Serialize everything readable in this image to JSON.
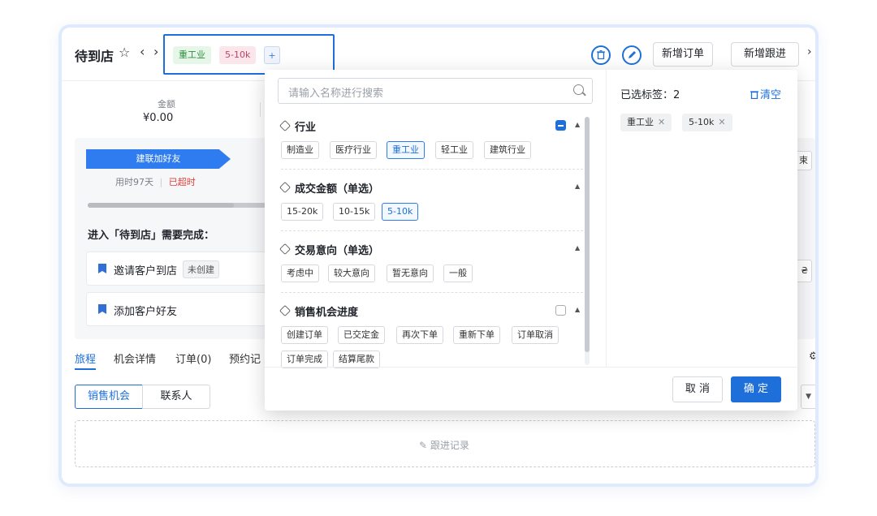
{
  "header": {
    "title": "待到店",
    "tags": [
      "重工业",
      "5-10k"
    ],
    "add_tag": "+",
    "buttons": {
      "new_order": "新增订单",
      "new_follow": "新增跟进"
    }
  },
  "summary": {
    "amount_label": "金额",
    "amount_value": "¥0.00"
  },
  "stage": {
    "name": "建联加好友",
    "time_used": "用时97天",
    "overdue": "已超时",
    "progress": 0.82
  },
  "requirements": {
    "title": "进入「待到店」需要完成：",
    "items": [
      {
        "label": "邀请客户到店",
        "badge": "未创建"
      },
      {
        "label": "添加客户好友",
        "badge": ""
      }
    ]
  },
  "side_stubs": [
    "束",
    "₴"
  ],
  "tabs": [
    "旅程",
    "机会详情",
    "订单(0)",
    "预约记"
  ],
  "segments": [
    "销售机会",
    "联系人"
  ],
  "follow_record": "跟进记录",
  "popup": {
    "search_placeholder": "请输入名称进行搜索",
    "categories": [
      {
        "title": "行业",
        "checkbox": "indeterminate",
        "options": [
          "制造业",
          "医疗行业",
          "重工业",
          "轻工业",
          "建筑行业"
        ],
        "selected": [
          "重工业"
        ]
      },
      {
        "title": "成交金额（单选）",
        "checkbox": "none",
        "options": [
          "15-20k",
          "10-15k",
          "5-10k"
        ],
        "selected": [
          "5-10k"
        ]
      },
      {
        "title": "交易意向（单选）",
        "checkbox": "none",
        "options": [
          "考虑中",
          "较大意向",
          "暂无意向",
          "一般"
        ],
        "selected": []
      },
      {
        "title": "销售机会进度",
        "checkbox": "unchecked",
        "options": [
          "创建订单",
          "已交定金",
          "再次下单",
          "重新下单",
          "订单取消",
          "订单完成",
          "结算尾款"
        ],
        "selected": []
      }
    ],
    "selected_title": "已选标签：2",
    "clear_label": "清空",
    "selected_tags": [
      "重工业",
      "5-10k"
    ],
    "cancel_label": "取 消",
    "confirm_label": "确 定"
  },
  "colors": {
    "accent": "#1e6fd9",
    "overdue": "#e0403a"
  }
}
